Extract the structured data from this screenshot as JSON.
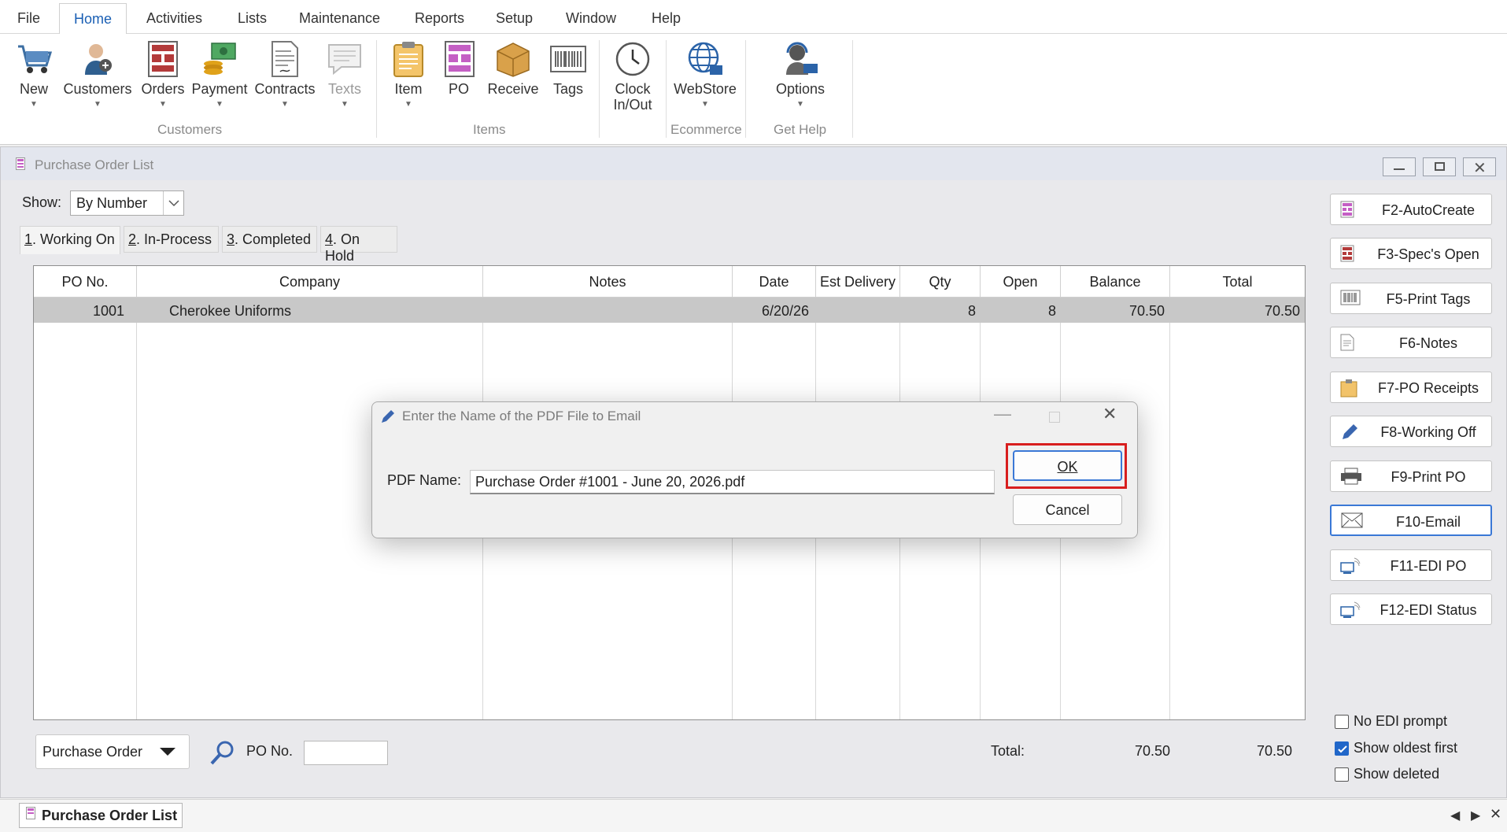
{
  "menu": {
    "items": [
      "File",
      "Home",
      "Activities",
      "Lists",
      "Maintenance",
      "Reports",
      "Setup",
      "Window",
      "Help"
    ],
    "active": "Home"
  },
  "ribbon": {
    "buttons": [
      {
        "label": "New",
        "icon": "shopping-cart-icon"
      },
      {
        "label": "Customers",
        "icon": "customer-person-icon"
      },
      {
        "label": "Orders",
        "icon": "orders-form-icon"
      },
      {
        "label": "Payment",
        "icon": "payment-money-icon"
      },
      {
        "label": "Contracts",
        "icon": "contract-document-icon"
      },
      {
        "label": "Texts",
        "icon": "speech-bubble-icon"
      },
      {
        "label": "Item",
        "icon": "clipboard-icon"
      },
      {
        "label": "PO",
        "icon": "po-form-icon"
      },
      {
        "label": "Receive",
        "icon": "box-icon"
      },
      {
        "label": "Tags",
        "icon": "barcode-icon"
      },
      {
        "label": "Clock",
        "label2": "In/Out",
        "icon": "clock-icon"
      },
      {
        "label": "WebStore",
        "icon": "globe-store-icon"
      },
      {
        "label": "Options",
        "icon": "support-headset-icon"
      }
    ],
    "groups": [
      "Customers",
      "Items",
      "Ecommerce",
      "Get Help"
    ]
  },
  "window": {
    "title": "Purchase Order List",
    "show_label": "Show:",
    "show_value": "By Number",
    "tabs": [
      {
        "num": "1",
        "label": ". Working On"
      },
      {
        "num": "2",
        "label": ". In-Process"
      },
      {
        "num": "3",
        "label": ". Completed"
      },
      {
        "num": "4",
        "label": ". On Hold"
      }
    ]
  },
  "grid": {
    "columns": [
      "PO No.",
      "Company",
      "Notes",
      "Date",
      "Est Delivery",
      "Qty",
      "Open",
      "Balance",
      "Total"
    ],
    "rows": [
      {
        "po_no": "1001",
        "company": "Cherokee Uniforms",
        "notes": "",
        "date": "6/20/26",
        "est_delivery": "",
        "qty": "8",
        "open": "8",
        "balance": "70.50",
        "total": "70.50"
      }
    ]
  },
  "side_buttons": [
    "F2-AutoCreate",
    "F3-Spec's Open",
    "F5-Print Tags",
    "F6-Notes",
    "F7-PO Receipts",
    "F8-Working Off",
    "F9-Print PO",
    "F10-Email",
    "F11-EDI PO",
    "F12-EDI Status"
  ],
  "checkboxes": [
    {
      "label": "No EDI prompt",
      "checked": false
    },
    {
      "label": "Show oldest first",
      "checked": true
    },
    {
      "label": "Show deleted",
      "checked": false
    }
  ],
  "footer": {
    "dropdown": "Purchase Order",
    "po_label": "PO No.",
    "total_label": "Total:",
    "balance_total": "70.50",
    "total_total": "70.50"
  },
  "dialog": {
    "title": "Enter the Name of the PDF File to Email",
    "field_label": "PDF Name:",
    "field_value": "Purchase Order #1001 - June 20, 2026.pdf",
    "ok": "OK",
    "cancel": "Cancel"
  },
  "taskbar": {
    "item": "Purchase Order List"
  }
}
